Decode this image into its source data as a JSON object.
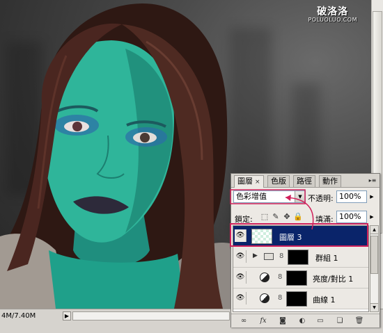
{
  "watermark": {
    "main": "破洛洛",
    "sub": "POLUOLUO.COM"
  },
  "status_bar": {
    "doc_size": "4M/7.40M",
    "arrow": "▶"
  },
  "layers_panel": {
    "tabs": [
      {
        "label": "圖層",
        "close": "×",
        "active": true
      },
      {
        "label": "色版",
        "active": false
      },
      {
        "label": "路徑",
        "active": false
      },
      {
        "label": "動作",
        "active": false
      }
    ],
    "menu_icon": "▸≡",
    "blend_mode": "色彩增值",
    "opacity_label": "不透明:",
    "opacity_value": "100%",
    "lock_label": "鎖定:",
    "fill_label": "填滿:",
    "fill_value": "100%",
    "layers": [
      {
        "name": "圖層 3",
        "selected": true,
        "kind": "pixel"
      },
      {
        "name": "群組 1",
        "selected": false,
        "kind": "group"
      },
      {
        "name": "亮度/對比 1",
        "selected": false,
        "kind": "adjustment"
      },
      {
        "name": "曲線 1",
        "selected": false,
        "kind": "adjustment"
      }
    ],
    "footer_icons": [
      "link-icon",
      "fx-icon",
      "mask-icon",
      "adjustment-layer-icon",
      "group-folder-icon",
      "new-layer-icon",
      "trash-icon"
    ]
  },
  "colors": {
    "selected_row": "#0a246a",
    "highlight_border": "#d0205a",
    "skin": "#2fb59a",
    "hair": "#3a1f1a"
  }
}
